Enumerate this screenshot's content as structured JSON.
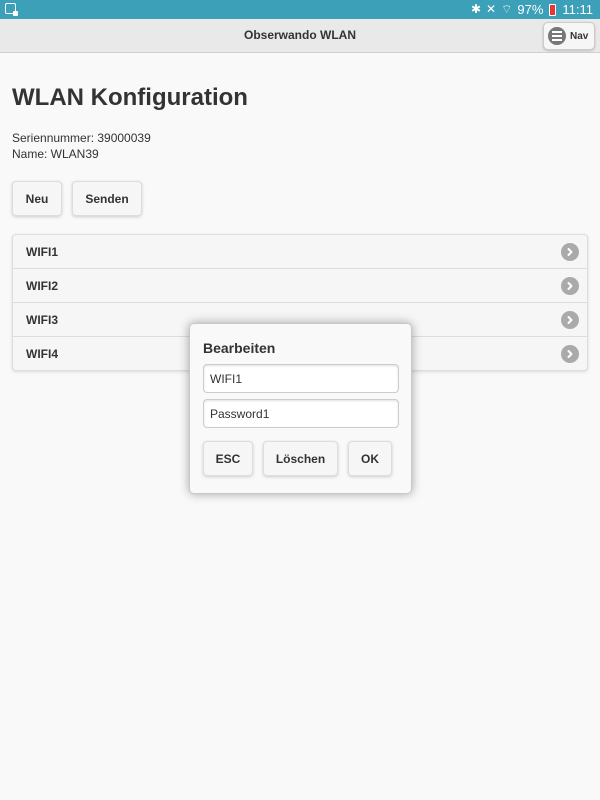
{
  "status_bar": {
    "battery": "97%",
    "time": "11:11"
  },
  "header": {
    "title": "Obserwando WLAN",
    "nav_label": "Nav"
  },
  "page": {
    "title": "WLAN Konfiguration",
    "serial_line": "Seriennummer: 39000039",
    "name_line": "Name: WLAN39",
    "new_button": "Neu",
    "send_button": "Senden"
  },
  "wifi_list": [
    {
      "label": "WIFI1"
    },
    {
      "label": "WIFI2"
    },
    {
      "label": "WIFI3"
    },
    {
      "label": "WIFI4"
    }
  ],
  "dialog": {
    "title": "Bearbeiten",
    "ssid_value": "WIFI1",
    "password_value": "Password1",
    "esc_button": "ESC",
    "delete_button": "Löschen",
    "ok_button": "OK"
  },
  "colors": {
    "status_bar": "#3ba0b8",
    "battery_alert": "#e53935",
    "header_bg": "#e9e9e9"
  }
}
